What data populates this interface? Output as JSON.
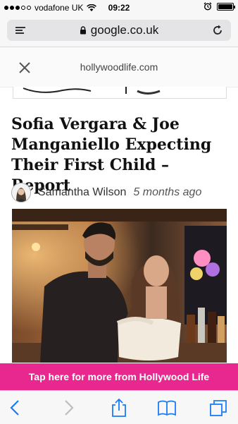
{
  "status_bar": {
    "carrier": "vodafone UK",
    "time": "09:22"
  },
  "browser": {
    "url": "google.co.uk",
    "site_title": "hollywoodlife.com"
  },
  "article": {
    "headline": "Sofia Vergara & Joe Manganiello Expecting Their First Child – Report",
    "author": "Samantha Wilson",
    "time_ago": "5 months ago"
  },
  "banner": {
    "text": "Tap here for more from Hollywood Life",
    "color": "#e8288e"
  },
  "toolbar": {
    "icons": [
      "back-icon",
      "forward-icon",
      "share-icon",
      "bookmarks-icon",
      "tabs-icon"
    ],
    "accent": "#1a7cf5"
  }
}
